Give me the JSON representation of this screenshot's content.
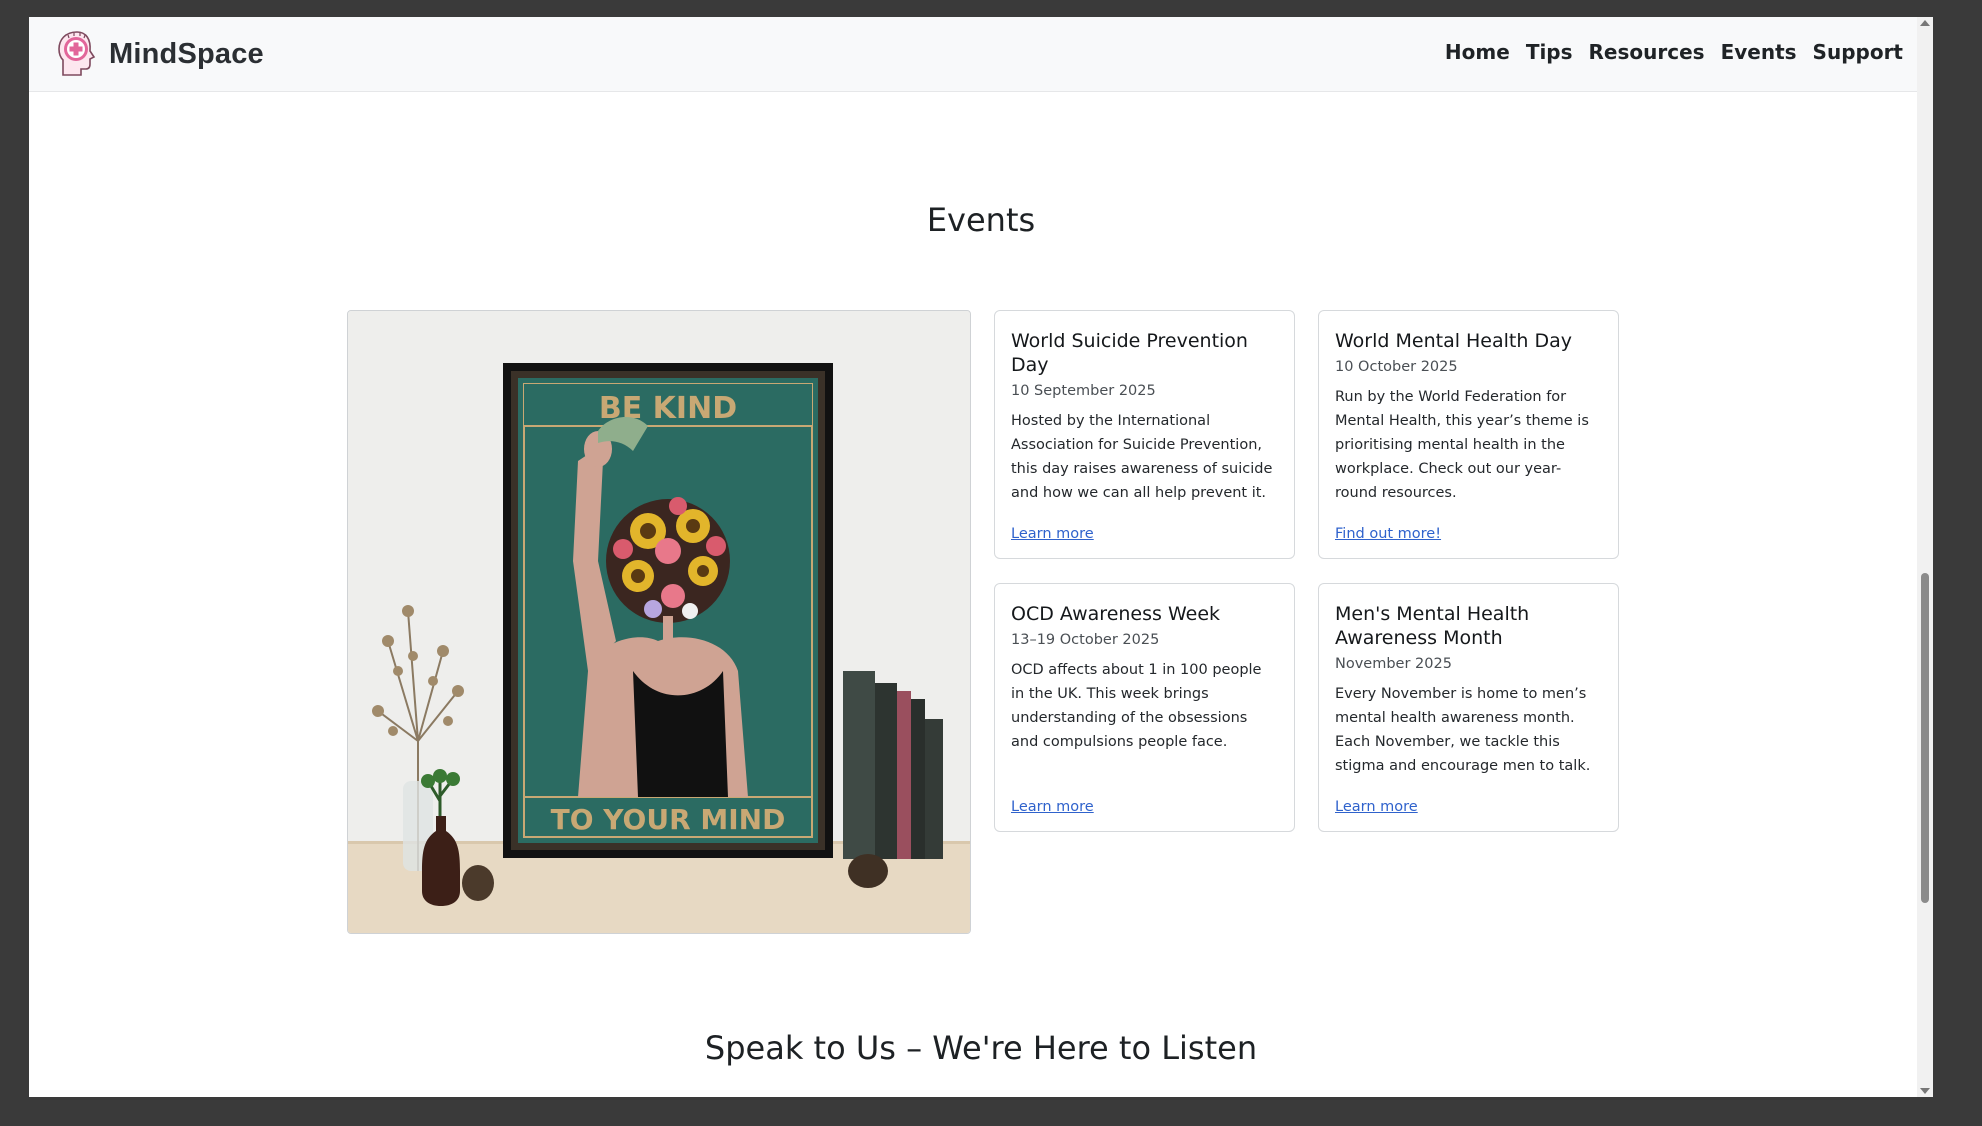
{
  "brand": {
    "name": "MindSpace",
    "logo_icon": "head-medical-cross-icon"
  },
  "nav": {
    "items": [
      "Home",
      "Tips",
      "Resources",
      "Events",
      "Support"
    ]
  },
  "events": {
    "title": "Events",
    "poster": {
      "top_text": "BE KIND",
      "bottom_text": "TO YOUR MIND"
    },
    "cards": [
      {
        "title": "World Suicide Prevention Day",
        "date": "10 September 2025",
        "text": "Hosted by the International Association for Suicide Prevention, this day raises awareness of suicide and how we can all help prevent it.",
        "link": "Learn more"
      },
      {
        "title": "World Mental Health Day",
        "date": "10 October 2025",
        "text": "Run by the World Federation for Mental Health, this year’s theme is prioritising mental health in the workplace. Check out our year-round resources.",
        "link": "Find out more!"
      },
      {
        "title": "OCD Awareness Week",
        "date": "13–19 October 2025",
        "text": "OCD affects about 1 in 100 people in the UK. This week brings understanding of the obsessions and compulsions people face.",
        "link": "Learn more"
      },
      {
        "title": "Men's Mental Health Awareness Month",
        "date": "November 2025",
        "text": "Every November is home to men’s mental health awareness month. Each November, we tackle this stigma and encourage men to talk.",
        "link": "Learn more"
      }
    ]
  },
  "speak": {
    "title": "Speak to Us – We're Here to Listen"
  },
  "colors": {
    "brand_pink": "#e2669a",
    "link_blue": "#2f62cc",
    "poster_teal": "#2b6b62",
    "poster_gold": "#c8a874"
  }
}
